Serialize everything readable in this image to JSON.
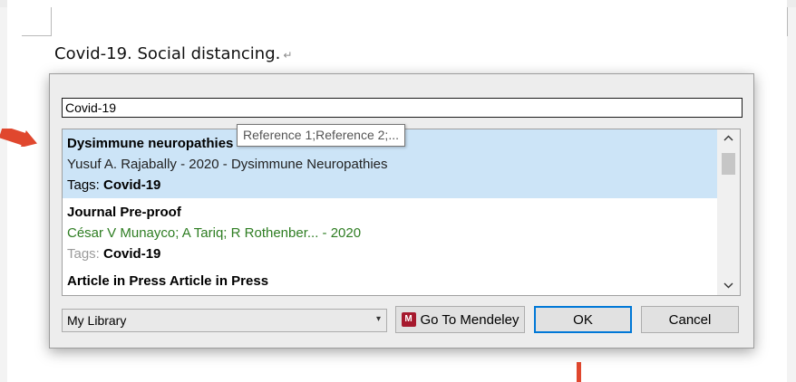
{
  "document": {
    "line_text": "Covid-19. Social distancing.",
    "paragraph_mark": "↵"
  },
  "dialog": {
    "search": {
      "value": "Covid-19"
    },
    "tooltip": "Reference 1;Reference 2;...",
    "results": [
      {
        "title": "Dysimmune neuropathies",
        "authors": "Yusuf A. Rajabally - 2020 - Dysimmune Neuropathies",
        "tags_label": "Tags:",
        "tag": "Covid-19",
        "selected": true
      },
      {
        "title": "Journal Pre-proof",
        "authors": "César V Munayco; A Tariq; R Rothenber... - 2020",
        "tags_label": "Tags:",
        "tag": "Covid-19",
        "selected": false
      },
      {
        "title": "Article in Press Article in Press",
        "selected": false
      }
    ],
    "scrollbar": {
      "up_icon": "chevron-up-icon",
      "down_icon": "chevron-down-icon"
    },
    "library_select": {
      "value": "My Library",
      "arrow": "▾"
    },
    "buttons": {
      "mendeley": "Go To Mendeley",
      "mendeley_logo": "M",
      "ok": "OK",
      "cancel": "Cancel"
    }
  },
  "colors": {
    "selection": "#cce4f7",
    "authors_green": "#2e7d22",
    "annotation_arrow": "#e0472e",
    "ok_focus": "#0078d7",
    "mendeley_brand": "#a6192e"
  }
}
